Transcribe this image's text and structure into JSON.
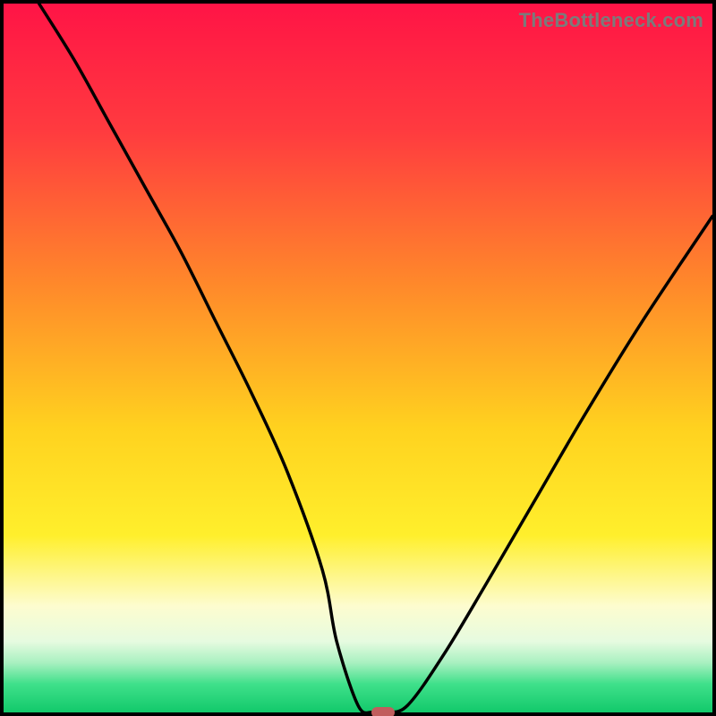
{
  "watermark": "TheBottleneck.com",
  "chart_data": {
    "type": "line",
    "title": "",
    "xlabel": "",
    "ylabel": "",
    "xlim": [
      0,
      100
    ],
    "ylim": [
      0,
      100
    ],
    "grid": false,
    "legend": false,
    "series": [
      {
        "name": "bottleneck-curve",
        "x": [
          5,
          10,
          15,
          20,
          25,
          30,
          35,
          40,
          45,
          47,
          50,
          52,
          54,
          57,
          62,
          68,
          75,
          82,
          90,
          100
        ],
        "y": [
          100,
          92,
          83,
          74,
          65,
          55,
          45,
          34,
          20,
          10,
          1,
          0,
          0,
          1,
          8,
          18,
          30,
          42,
          55,
          70
        ]
      }
    ],
    "marker": {
      "x": 53,
      "y": 0.5,
      "color": "#c15d5d"
    },
    "gradient_stops": [
      {
        "offset": 0,
        "color": "#ff1446"
      },
      {
        "offset": 18,
        "color": "#ff3b3f"
      },
      {
        "offset": 40,
        "color": "#ff8a2a"
      },
      {
        "offset": 60,
        "color": "#ffd21f"
      },
      {
        "offset": 75,
        "color": "#ffef2c"
      },
      {
        "offset": 85,
        "color": "#fdfccf"
      },
      {
        "offset": 90,
        "color": "#e6fbe0"
      },
      {
        "offset": 93,
        "color": "#a8f0c0"
      },
      {
        "offset": 96,
        "color": "#3fe08a"
      },
      {
        "offset": 100,
        "color": "#12c96b"
      }
    ]
  }
}
